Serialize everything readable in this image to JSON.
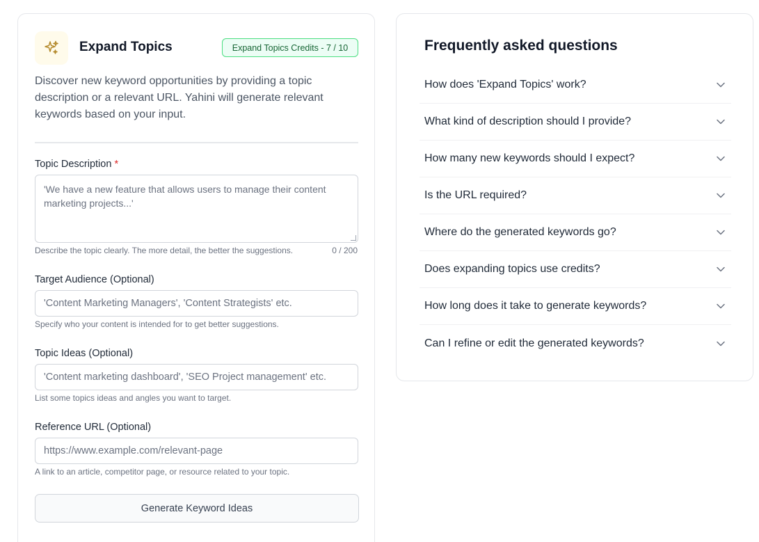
{
  "expand": {
    "title": "Expand Topics",
    "credits_badge": "Expand Topics Credits - 7 / 10",
    "intro": "Discover new keyword opportunities by providing a topic description or a relevant URL. Yahini will generate relevant keywords based on your input.",
    "topic_description": {
      "label": "Topic Description",
      "required_mark": "*",
      "placeholder": "'We have a new feature that allows users to manage their content marketing projects...'",
      "help": "Describe the topic clearly. The more detail, the better the suggestions.",
      "counter": "0 / 200"
    },
    "target_audience": {
      "label": "Target Audience (Optional)",
      "placeholder": "'Content Marketing Managers', 'Content Strategists' etc.",
      "help": "Specify who your content is intended for to get better suggestions."
    },
    "topic_ideas": {
      "label": "Topic Ideas (Optional)",
      "placeholder": "'Content marketing dashboard', 'SEO Project management' etc.",
      "help": "List some topics ideas and angles you want to target."
    },
    "reference_url": {
      "label": "Reference URL (Optional)",
      "placeholder": "https://www.example.com/relevant-page",
      "help": "A link to an article, competitor page, or resource related to your topic."
    },
    "generate_label": "Generate Keyword Ideas"
  },
  "faq": {
    "title": "Frequently asked questions",
    "items": [
      "How does 'Expand Topics' work?",
      "What kind of description should I provide?",
      "How many new keywords should I expect?",
      "Is the URL required?",
      "Where do the generated keywords go?",
      "Does expanding topics use credits?",
      "How long does it take to generate keywords?",
      "Can I refine or edit the generated keywords?"
    ]
  },
  "icons": {
    "header": "sparkles-icon",
    "faq_toggle": "chevron-down-icon"
  },
  "colors": {
    "accent_icon": "#b48a2c",
    "badge_border": "#4ade80",
    "badge_bg": "#ecfdf5",
    "required": "#dc2626"
  }
}
